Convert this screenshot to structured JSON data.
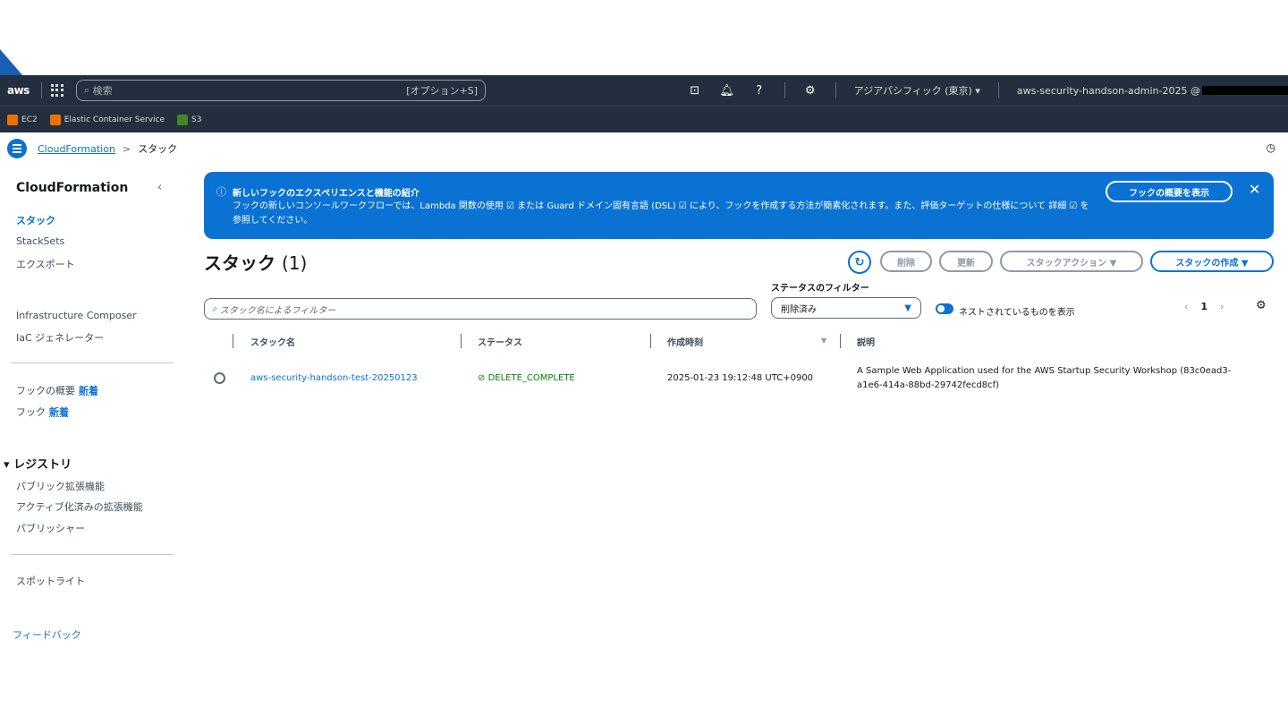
{
  "topbar": {
    "logo": "aws",
    "search_placeholder": "検索",
    "search_hint": "[オプション+S]",
    "icons": [
      "cloudshell-icon",
      "bell-icon",
      "help-icon",
      "settings-icon"
    ],
    "region": "アジアパシフィック (東京) ▾",
    "account": "aws-security-handson-admin-2025 @"
  },
  "favorites": [
    {
      "label": "EC2",
      "color": "#ed7100"
    },
    {
      "label": "Elastic Container Service",
      "color": "#ed7100"
    },
    {
      "label": "S3",
      "color": "#3f8624"
    }
  ],
  "breadcrumb": {
    "root": "CloudFormation",
    "separator": ">",
    "current": "スタック"
  },
  "sidebar": {
    "title": "CloudFormation",
    "items": [
      {
        "label": "スタック",
        "active": true
      },
      {
        "label": "StackSets"
      },
      {
        "label": "エクスポート"
      },
      {
        "label": "Infrastructure Composer"
      },
      {
        "label": "IaC ジェネレーター"
      },
      {
        "label": "フックの概要",
        "badge": "新着"
      },
      {
        "label": "フック",
        "badge": "新着"
      }
    ],
    "registry_section": "レジストリ",
    "registry_items": [
      "パブリック拡張機能",
      "アクティブ化済みの拡張機能",
      "パブリッシャー"
    ],
    "spotlight": "スポットライト",
    "feedback": "フィードバック"
  },
  "banner": {
    "title": "新しいフックのエクスペリエンスと機能の紹介",
    "body": "フックの新しいコンソールワークフローでは、Lambda 関数の使用 ☑ または Guard ドメイン固有言語 (DSL) ☑ により、フックを作成する方法が簡素化されます。また、評価ターゲットの仕様について 詳細 ☑ を参照してください。",
    "button": "フックの概要を表示",
    "close": "✕"
  },
  "stacks": {
    "title": "スタック",
    "count": "(1)",
    "buttons": {
      "delete": "削除",
      "update": "更新",
      "actions": "スタックアクション ▼",
      "create": "スタックの作成 ▼"
    },
    "filter_placeholder": "スタック名によるフィルター",
    "status_filter_label": "ステータスのフィルター",
    "status_filter_value": "削除済み",
    "nested_toggle_label": "ネストされているものを表示",
    "page": "1",
    "columns": [
      "スタック名",
      "ステータス",
      "作成時刻",
      "説明"
    ],
    "rows": [
      {
        "name": "aws-security-handson-test-20250123",
        "status": "DELETE_COMPLETE",
        "created": "2025-01-23 19:12:48 UTC+0900",
        "description": "A Sample Web Application used for the AWS Startup Security Workshop (83c0ead3-a1e6-414a-88bd-29742fecd8cf)"
      }
    ]
  }
}
